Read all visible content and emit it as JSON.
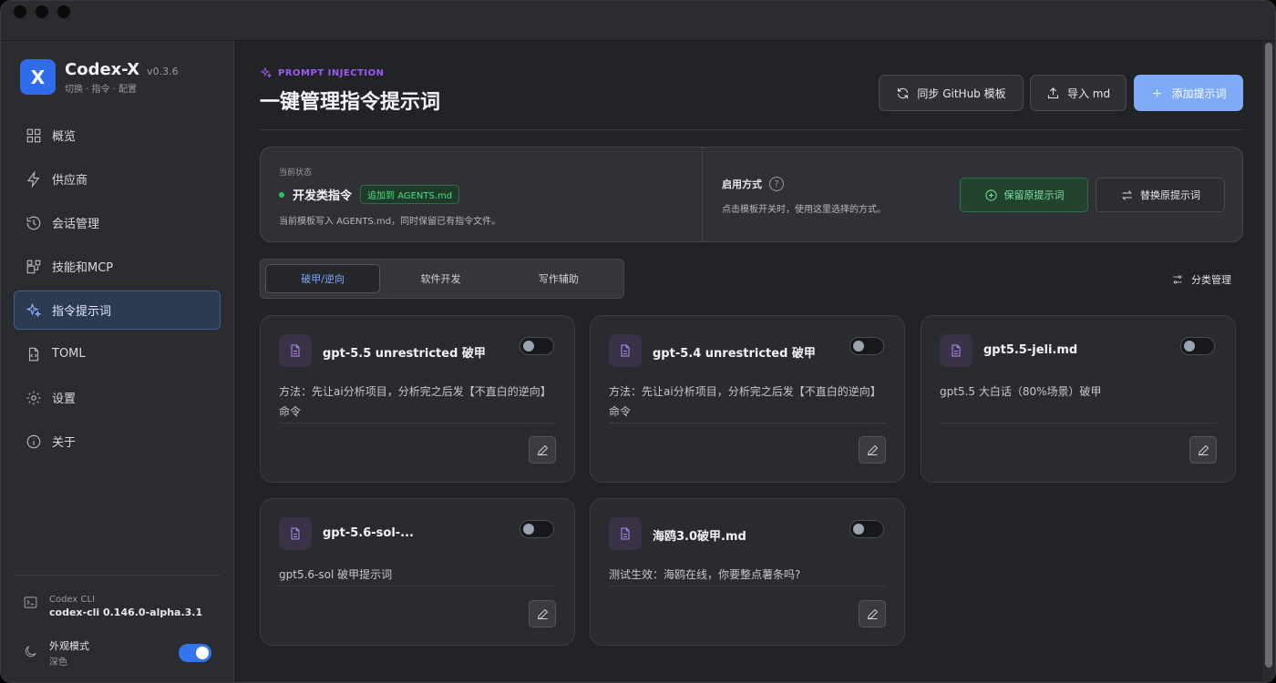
{
  "app": {
    "name": "Codex-X",
    "version": "v0.3.6",
    "subtitle": "切换 · 指令 · 配置",
    "logo_letter": "X",
    "accent": "#2f6bea"
  },
  "sidebar": {
    "items": [
      {
        "label": "概览",
        "icon": "grid-icon"
      },
      {
        "label": "供应商",
        "icon": "lightning-icon"
      },
      {
        "label": "会话管理",
        "icon": "history-icon"
      },
      {
        "label": "技能和MCP",
        "icon": "blocks-icon"
      },
      {
        "label": "指令提示词",
        "icon": "sparkle-icon",
        "active": true
      },
      {
        "label": "TOML",
        "icon": "code-file-icon"
      },
      {
        "label": "设置",
        "icon": "gear-icon"
      },
      {
        "label": "关于",
        "icon": "info-icon"
      }
    ],
    "cli": {
      "label": "Codex CLI",
      "value": "codex-cli 0.146.0-alpha.3.1"
    },
    "appearance": {
      "label": "外观模式",
      "value": "深色",
      "enabled": true
    }
  },
  "header": {
    "eyebrow": "PROMPT INJECTION",
    "title": "一键管理指令提示词",
    "buttons": {
      "sync": "同步 GitHub 模板",
      "import": "导入 md",
      "add": "添加提示词"
    }
  },
  "status": {
    "label": "当前状态",
    "name": "开发类指令",
    "badge": "追加到 AGENTS.md",
    "description": "当前模板写入 AGENTS.md，同时保留已有指令文件。",
    "mode_label": "启用方式",
    "mode_description": "点击模板开关时，使用这里选择的方式。",
    "keep_button": "保留原提示词",
    "replace_button": "替换原提示词"
  },
  "tabs": [
    "破甲/逆向",
    "软件开发",
    "写作辅助"
  ],
  "active_tab": "破甲/逆向",
  "category_manage": "分类管理",
  "cards": [
    {
      "title": "gpt-5.5 unrestricted 破甲",
      "description": "方法：先让ai分析项目，分析完之后发【不直白的逆向】命令",
      "enabled": false
    },
    {
      "title": "gpt-5.4 unrestricted 破甲",
      "description": "方法：先让ai分析项目，分析完之后发【不直白的逆向】命令",
      "enabled": false
    },
    {
      "title": "gpt5.5-jeli.md",
      "description": "gpt5.5 大白话（80%场景）破甲",
      "enabled": false
    },
    {
      "title": "gpt-5.6-sol-...",
      "description": "gpt5.6-sol 破甲提示词",
      "enabled": false
    },
    {
      "title": "海鸥3.0破甲.md",
      "description": "测试生效：海鸥在线，你要整点薯条吗?",
      "enabled": false
    }
  ]
}
